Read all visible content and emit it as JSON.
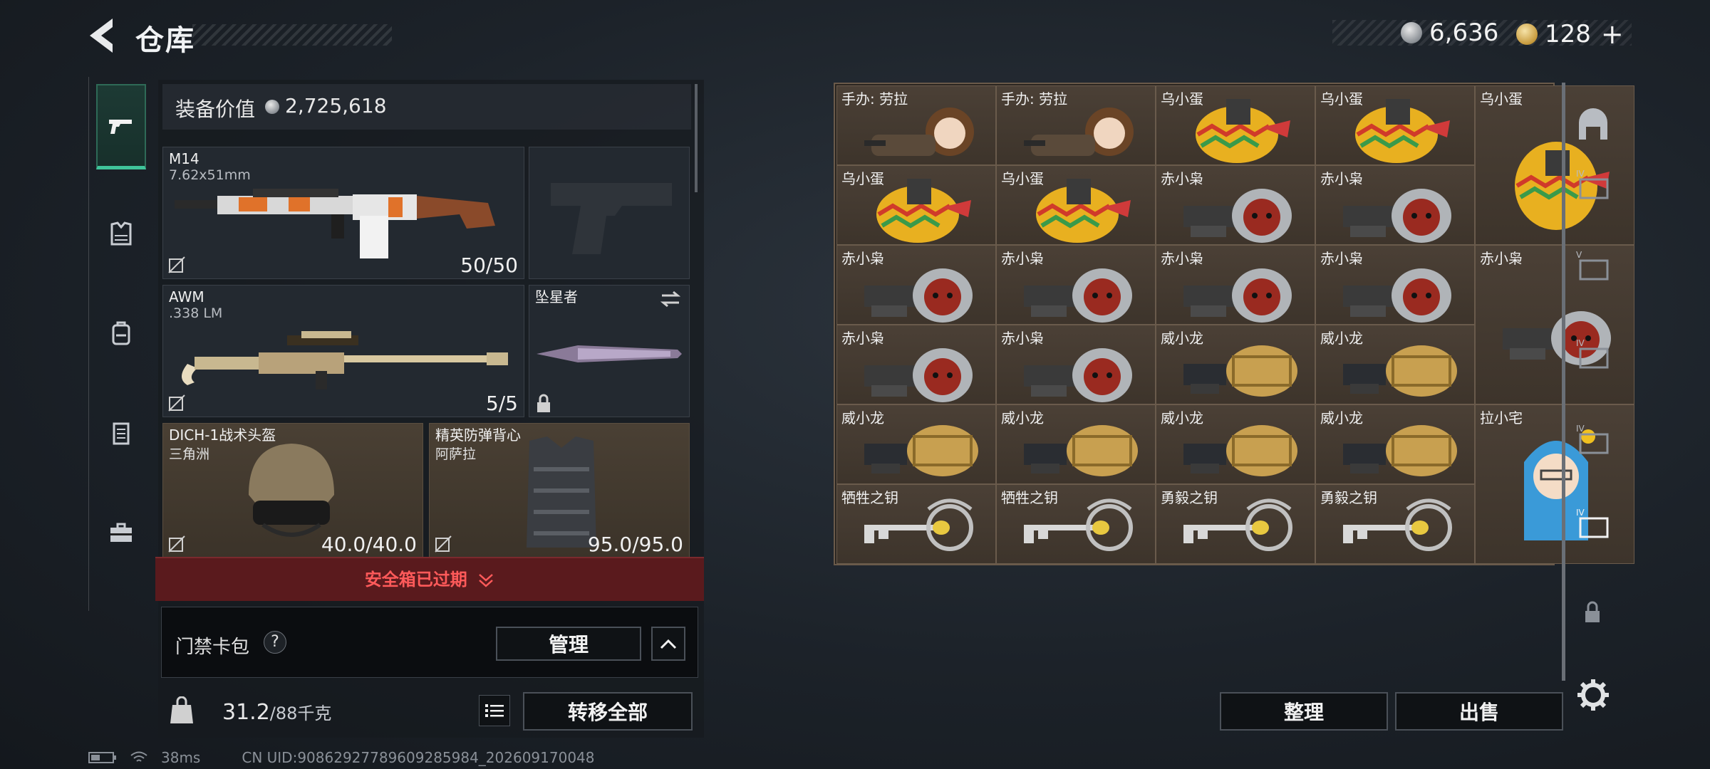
{
  "header": {
    "title": "仓库",
    "currency_silver": "6,636",
    "currency_gold": "128",
    "plus": "+"
  },
  "nav": {
    "items": [
      "weapons-icon",
      "armor-icon",
      "backpack-icon",
      "rig-icon",
      "case-icon"
    ]
  },
  "left": {
    "value_label": "装备价值",
    "value_amount": "2,725,618",
    "slots": {
      "primary": {
        "name": "M14",
        "caliber": "7.62x51mm",
        "ammo": "50/50"
      },
      "secondary": {
        "name": "AWM",
        "caliber": ".338 LM",
        "ammo": "5/5"
      },
      "melee": {
        "name": "坠星者"
      },
      "helmet": {
        "name": "DICH-1战术头盔",
        "sub": "三角洲",
        "durability": "40.0/40.0"
      },
      "vest": {
        "name": "精英防弹背心",
        "sub": "阿萨拉",
        "durability": "95.0/95.0"
      }
    },
    "expired_text": "安全箱已过期",
    "cardpack_label": "门禁卡包",
    "help": "?",
    "manage_label": "管理",
    "weight_value": "31.2",
    "weight_max": "/88千克",
    "transfer_all_label": "转移全部"
  },
  "grid": {
    "items": [
      {
        "label": "手办: 劳拉",
        "icon": "figure-lara"
      },
      {
        "label": "手办: 劳拉",
        "icon": "figure-lara"
      },
      {
        "label": "乌小蛋",
        "icon": "egg-figure"
      },
      {
        "label": "乌小蛋",
        "icon": "egg-figure"
      },
      {
        "label": "乌小蛋",
        "icon": "egg-figure-tall"
      },
      {
        "label": "乌小蛋",
        "icon": "egg-figure"
      },
      {
        "label": "乌小蛋",
        "icon": "egg-figure"
      },
      {
        "label": "赤小枭",
        "icon": "red-owl-figure"
      },
      {
        "label": "赤小枭",
        "icon": "red-owl-figure"
      },
      {
        "label": "赤小枭",
        "icon": "red-owl-figure"
      },
      {
        "label": "赤小枭",
        "icon": "red-owl-figure"
      },
      {
        "label": "赤小枭",
        "icon": "red-owl-figure"
      },
      {
        "label": "赤小枭",
        "icon": "red-owl-figure"
      },
      {
        "label": "赤小枭",
        "icon": "red-owl-figure-tall"
      },
      {
        "label": "赤小枭",
        "icon": "red-owl-figure"
      },
      {
        "label": "赤小枭",
        "icon": "red-owl-figure"
      },
      {
        "label": "威小龙",
        "icon": "gold-dragon-figure"
      },
      {
        "label": "威小龙",
        "icon": "gold-dragon-figure"
      },
      {
        "label": "威小龙",
        "icon": "gold-dragon-figure"
      },
      {
        "label": "威小龙",
        "icon": "gold-dragon-figure"
      },
      {
        "label": "威小龙",
        "icon": "gold-dragon-figure"
      },
      {
        "label": "威小龙",
        "icon": "gold-dragon-figure"
      },
      {
        "label": "拉小宅",
        "icon": "blue-hood-figure-tall"
      },
      {
        "label": "牺牲之钥",
        "icon": "ornate-key"
      },
      {
        "label": "牺牲之钥",
        "icon": "ornate-key"
      },
      {
        "label": "勇毅之钥",
        "icon": "ornate-key"
      },
      {
        "label": "勇毅之钥",
        "icon": "ornate-key"
      }
    ],
    "sort_label": "整理",
    "sell_label": "出售"
  },
  "status": {
    "ping": "38ms",
    "uid": "CN UID:9086292778960928598​4_202609170048"
  },
  "colors": {
    "accent": "#3fc49a",
    "expired": "#ff5a5a",
    "cell_bg": "#4b4036"
  }
}
